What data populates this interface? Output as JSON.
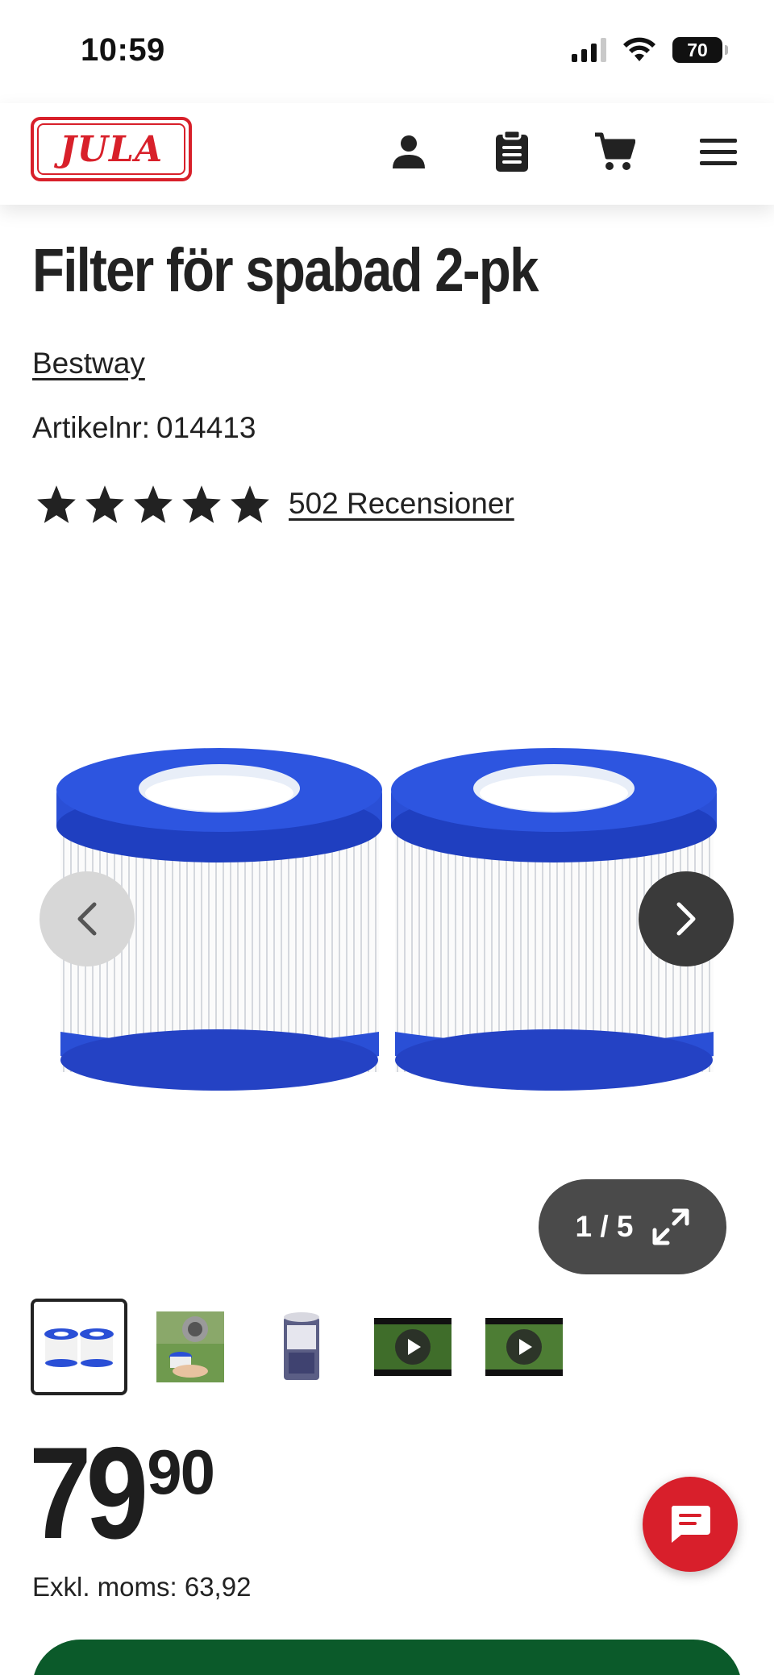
{
  "status_bar": {
    "time": "10:59",
    "battery": "70"
  },
  "header": {
    "logo_text": "JULA",
    "brand_color": "#d8202a"
  },
  "product": {
    "title": "Filter för spabad 2-pk",
    "brand": "Bestway",
    "article_label": "Artikelnr:",
    "article_number": "014413",
    "rating": 5,
    "reviews": "502 Recensioner"
  },
  "gallery": {
    "counter": "1 / 5",
    "thumbnails": [
      "filters",
      "filter-in-hand",
      "filter-box",
      "video-1",
      "video-2"
    ]
  },
  "price": {
    "main": "79",
    "decimals": "90",
    "excl_vat": "Exkl. moms: 63,92"
  },
  "colors": {
    "accent_red": "#d81f2b",
    "buy_green": "#0b5a2a",
    "filter_blue": "#2a4fd6"
  }
}
